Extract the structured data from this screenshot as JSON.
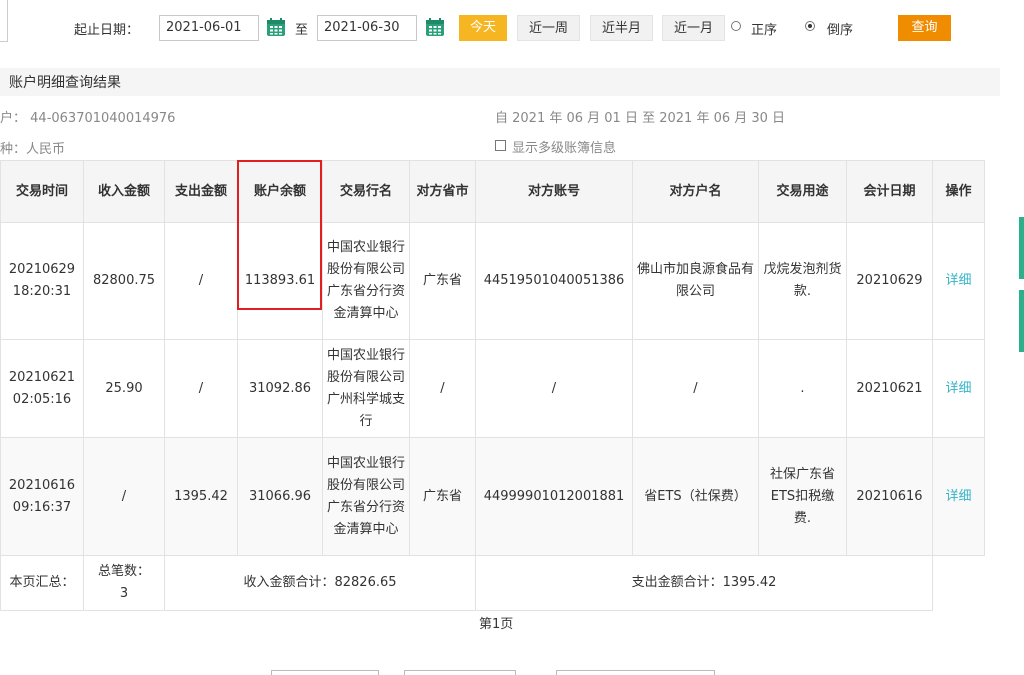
{
  "filter": {
    "date_label": "起止日期：",
    "start_date": "2021-06-01",
    "to_label": "至",
    "end_date": "2021-06-30",
    "today_label": "今天",
    "week_label": "近一周",
    "half_month_label": "近半月",
    "month_label": "近一月",
    "asc_label": "正序",
    "desc_label": "倒序",
    "selected_order": "desc",
    "query_label": "查询"
  },
  "result": {
    "title": "账户明细查询结果",
    "account_label": "账户：",
    "account_label_visible": "长户：",
    "account_number": "44-063701040014976",
    "range_text": "自 2021 年 06 月 01 日 至 2021 年 06 月 30 日",
    "currency_text": "币种：人民币",
    "multi_level_label": "显示多级账簿信息"
  },
  "table": {
    "headers": [
      "交易时间",
      "收入金额",
      "支出金额",
      "账户余额",
      "交易行名",
      "对方省市",
      "对方账号",
      "对方户名",
      "交易用途",
      "会计日期",
      "操作"
    ],
    "rows": [
      {
        "date": "20210629",
        "time": "18:20:31",
        "income": "82800.75",
        "expense": "/",
        "balance": "113893.61",
        "bank": "中国农业银行股份有限公司广东省分行资金清算中心",
        "province": "广东省",
        "account": "44519501040051386",
        "name": "佛山市加良源食品有限公司",
        "purpose": "戊烷发泡剂货款.",
        "acct_date": "20210629",
        "action": "详细"
      },
      {
        "date": "20210621",
        "time": "02:05:16",
        "income": "25.90",
        "expense": "/",
        "balance": "31092.86",
        "bank": "中国农业银行股份有限公司广州科学城支行",
        "province": "/",
        "account": "/",
        "name": "/",
        "purpose": ".",
        "acct_date": "20210621",
        "action": "详细"
      },
      {
        "date": "20210616",
        "time": "09:16:37",
        "income": "/",
        "expense": "1395.42",
        "balance": "31066.96",
        "bank": "中国农业银行股份有限公司广东省分行资金清算中心",
        "province": "广东省",
        "account": "44999901012001881",
        "name": "省ETS（社保费）",
        "purpose": "社保广东省ETS扣税缴费.",
        "acct_date": "20210616",
        "action": "详细"
      }
    ],
    "summary": {
      "page_label": "本页汇总：",
      "count_label": "总笔数：",
      "count": "3",
      "income_total": "收入金额合计：82826.65",
      "expense_total": "支出金额合计：1395.42"
    }
  },
  "pagination": {
    "page_text": "第1页"
  },
  "colors": {
    "today_button": "#f5b622",
    "query_button": "#f08c00",
    "link": "#35b5c8",
    "highlight_box": "#e02020",
    "calendar_icon": "#2aa07a"
  }
}
